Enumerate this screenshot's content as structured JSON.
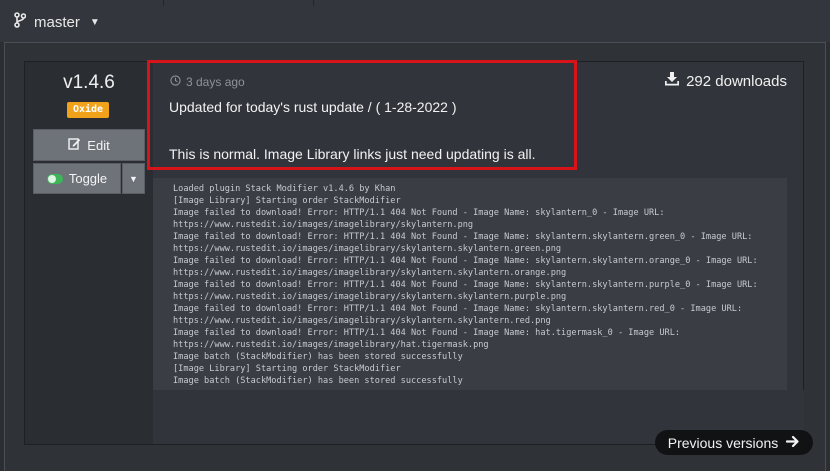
{
  "branch": {
    "name": "master"
  },
  "release": {
    "version": "v1.4.6",
    "badge": "Oxide",
    "time_ago": "3 days ago",
    "notes_line1": "Updated for today's rust update / ( 1-28-2022 )",
    "notes_line2": "This is normal. Image Library links just need updating is all.",
    "downloads": "292 downloads"
  },
  "buttons": {
    "edit": "Edit",
    "toggle": "Toggle",
    "previous_versions": "Previous versions"
  },
  "log_lines": [
    "Loaded plugin Stack Modifier v1.4.6 by Khan",
    "[Image Library] Starting order StackModifier",
    "Image failed to download! Error: HTTP/1.1 404 Not Found - Image Name: skylantern_0 - Image URL:",
    "https://www.rustedit.io/images/imagelibrary/skylantern.png",
    "Image failed to download! Error: HTTP/1.1 404 Not Found - Image Name: skylantern.skylantern.green_0 - Image URL:",
    "https://www.rustedit.io/images/imagelibrary/skylantern.skylantern.green.png",
    "Image failed to download! Error: HTTP/1.1 404 Not Found - Image Name: skylantern.skylantern.orange_0 - Image URL:",
    "https://www.rustedit.io/images/imagelibrary/skylantern.skylantern.orange.png",
    "Image failed to download! Error: HTTP/1.1 404 Not Found - Image Name: skylantern.skylantern.purple_0 - Image URL:",
    "https://www.rustedit.io/images/imagelibrary/skylantern.skylantern.purple.png",
    "Image failed to download! Error: HTTP/1.1 404 Not Found - Image Name: skylantern.skylantern.red_0 - Image URL:",
    "https://www.rustedit.io/images/imagelibrary/skylantern.skylantern.red.png",
    "Image failed to download! Error: HTTP/1.1 404 Not Found - Image Name: hat.tigermask_0 - Image URL:",
    "https://www.rustedit.io/images/imagelibrary/hat.tigermask.png",
    "Image batch (StackModifier) has been stored successfully",
    "[Image Library] Starting order StackModifier",
    "Image batch (StackModifier) has been stored successfully"
  ],
  "colors": {
    "badge": "#f0a21a",
    "highlight": "#d8141a",
    "toggle_on": "#3fb55a"
  },
  "icons": {
    "branch": "code-branch-icon",
    "clock": "clock-icon",
    "download": "download-icon",
    "edit": "edit-icon",
    "toggle": "toggle-switch-icon",
    "arrow": "arrow-right-icon"
  }
}
